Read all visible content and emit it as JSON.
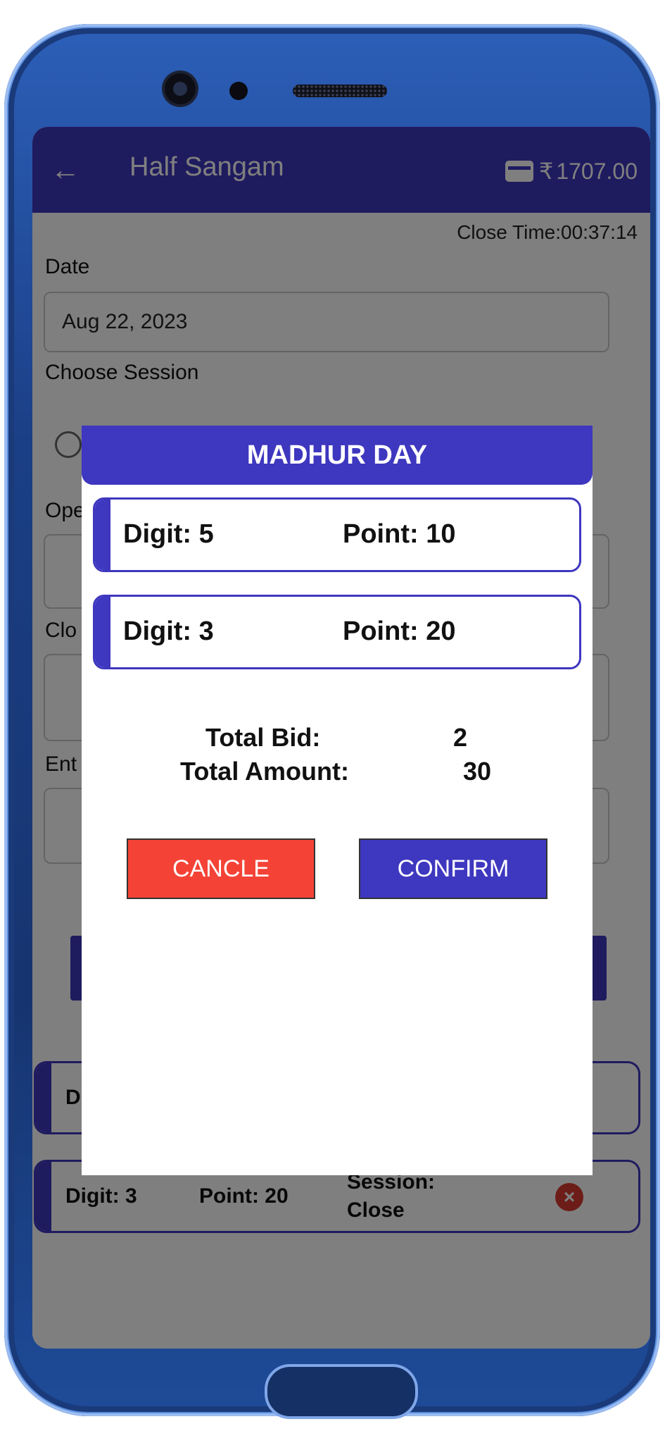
{
  "appbar": {
    "title": "Half Sangam",
    "currency": "₹",
    "balance": "1707.00"
  },
  "close_time": "Close Time:00:37:14",
  "form": {
    "date_label": "Date",
    "date_value": "Aug 22, 2023",
    "session_label": "Choose Session",
    "open_label_partial": "Ope",
    "close_label_partial": "Clo",
    "enter_label_partial": "Ent"
  },
  "bid_rows": [
    {
      "digit_partial": "Di"
    },
    {
      "digit": "Digit: 3",
      "point": "Point: 20",
      "session_line1": "Session:",
      "session_line2": "Close"
    }
  ],
  "dialog": {
    "title": "MADHUR DAY",
    "bids": [
      {
        "digit": "Digit: 5",
        "point": "Point: 10"
      },
      {
        "digit": "Digit: 3",
        "point": "Point: 20"
      }
    ],
    "total_bid_label": "Total Bid:",
    "total_bid_value": "2",
    "total_amount_label": "Total Amount:",
    "total_amount_value": "30",
    "cancel_label": "CANCLE",
    "confirm_label": "CONFIRM"
  },
  "colors": {
    "primary": "#3e37bf",
    "cancel": "#f44336",
    "delete": "#d93a2f"
  },
  "icons": {
    "back": "arrow-left-icon",
    "wallet": "wallet-icon",
    "delete": "close-circle-icon"
  }
}
